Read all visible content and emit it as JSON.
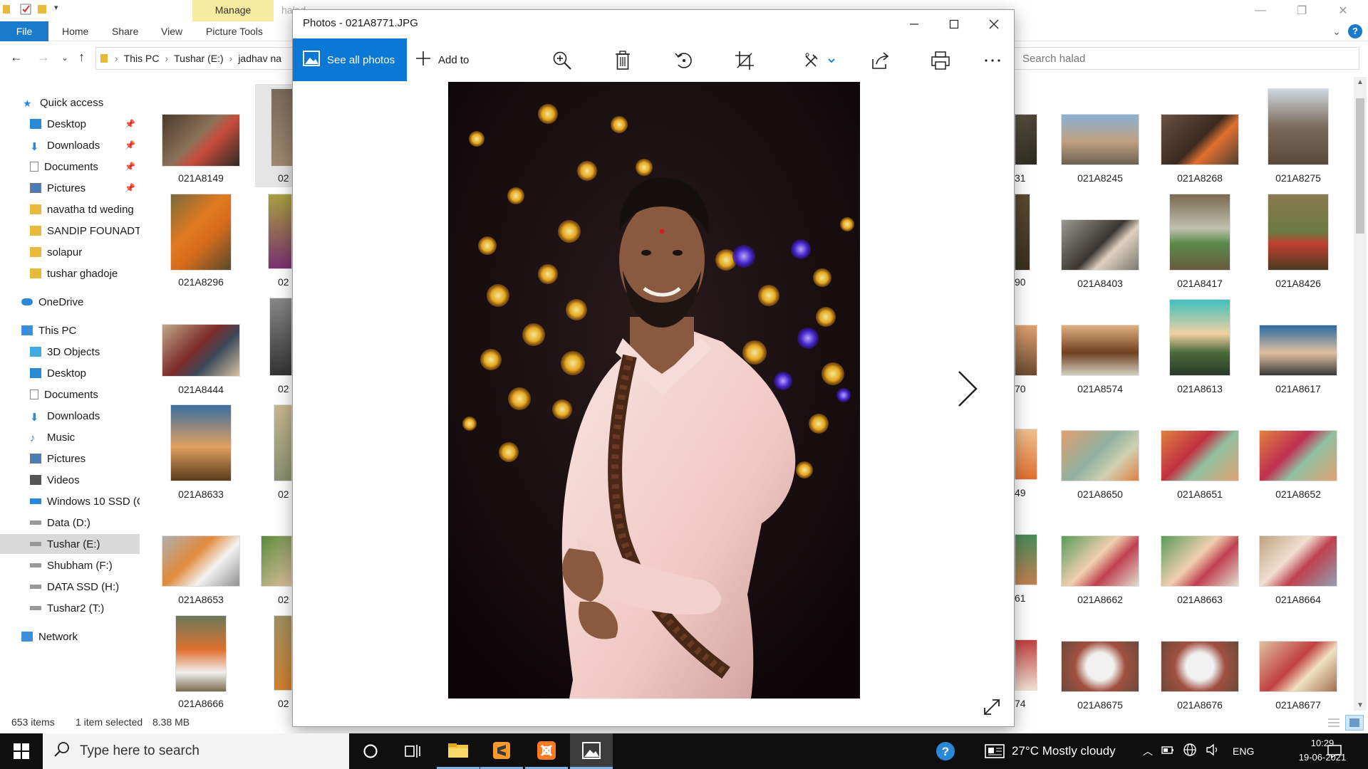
{
  "explorer": {
    "ribbon": {
      "manage_label": "Manage",
      "picture_tools_label": "Picture Tools",
      "ghost_title": "halad",
      "tabs": [
        "File",
        "Home",
        "Share",
        "View"
      ]
    },
    "address": {
      "segments": [
        "This PC",
        "Tushar (E:)",
        "jadhav na"
      ],
      "search_placeholder": "Search halad"
    },
    "nav": {
      "quick_access": "Quick access",
      "quick_items": [
        "Desktop",
        "Downloads",
        "Documents",
        "Pictures",
        "navatha td weding",
        "SANDIP FOUNADTIO",
        "solapur",
        "tushar ghadoje"
      ],
      "onedrive": "OneDrive",
      "this_pc": "This PC",
      "pc_items": [
        "3D Objects",
        "Desktop",
        "Documents",
        "Downloads",
        "Music",
        "Pictures",
        "Videos",
        "Windows 10 SSD (C",
        "Data (D:)",
        "Tushar (E:)",
        "Shubham (F:)",
        "DATA SSD (H:)",
        "Tushar2 (T:)"
      ],
      "network": "Network"
    },
    "files_left": [
      "021A8149",
      "021A8296",
      "021A8444",
      "021A8633",
      "021A8653",
      "021A8666"
    ],
    "files_left_partial": [
      "02",
      "02",
      "02",
      "02",
      "02",
      "02"
    ],
    "files_right_partial": [
      "31",
      "90",
      "70",
      "49",
      "61",
      "74"
    ],
    "files_right": [
      [
        "021A8245",
        "021A8268",
        "021A8275"
      ],
      [
        "021A8403",
        "021A8417",
        "021A8426"
      ],
      [
        "021A8574",
        "021A8613",
        "021A8617"
      ],
      [
        "021A8650",
        "021A8651",
        "021A8652"
      ],
      [
        "021A8662",
        "021A8663",
        "021A8664"
      ],
      [
        "021A8675",
        "021A8676",
        "021A8677"
      ]
    ],
    "status": {
      "items": "653 items",
      "selected": "1 item selected",
      "size": "8.38 MB"
    }
  },
  "photos": {
    "title": "Photos - 021A8771.JPG",
    "see_all": "See all photos",
    "add_to": "Add to"
  },
  "taskbar": {
    "search_placeholder": "Type here to search",
    "weather": "27°C  Mostly cloudy",
    "lang": "ENG",
    "time": "10:29",
    "date": "19-06-2021"
  }
}
